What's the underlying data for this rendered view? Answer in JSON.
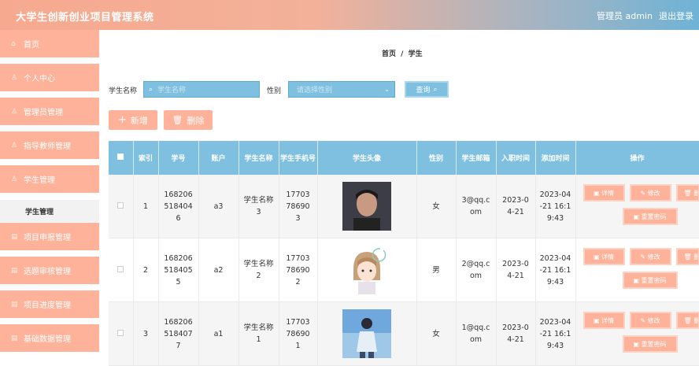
{
  "header": {
    "title": "大学生创新创业项目管理系统",
    "user": "管理员 admin",
    "logout": "退出登录"
  },
  "sidebar": {
    "items": [
      {
        "label": "首页",
        "icon": "home-icon"
      },
      {
        "label": "个人中心",
        "icon": "user-icon"
      },
      {
        "label": "管理员管理",
        "icon": "user-icon"
      },
      {
        "label": "指导教师管理",
        "icon": "user-icon"
      },
      {
        "label": "学生管理",
        "icon": "user-icon"
      },
      {
        "label": "项目申报管理",
        "icon": "doc-icon"
      },
      {
        "label": "选题审核管理",
        "icon": "doc-icon"
      },
      {
        "label": "项目进度管理",
        "icon": "doc-icon"
      },
      {
        "label": "基础数据管理",
        "icon": "doc-icon"
      }
    ],
    "active_sub": "学生管理"
  },
  "breadcrumb": [
    "首页",
    "/",
    "学生"
  ],
  "search": {
    "name_label": "学生名称",
    "name_placeholder": "学生名称",
    "gender_label": "性别",
    "gender_placeholder": "请选择性别",
    "query_label": "查询"
  },
  "actions": {
    "add": "新增",
    "delete": "删除"
  },
  "table": {
    "headers": [
      "",
      "索引",
      "学号",
      "账户",
      "学生名称",
      "学生手机号",
      "学生头像",
      "性别",
      "学生邮箱",
      "入职时间",
      "添加时间",
      "操作"
    ],
    "rows": [
      {
        "index": "1",
        "id": "1682065184046",
        "account": "a3",
        "name": "学生名称3",
        "phone": "17703786903",
        "gender": "女",
        "email": "3@qq.com",
        "join": "2023-04-21",
        "added": "2023-04-21 16:19:43"
      },
      {
        "index": "2",
        "id": "1682065184055",
        "account": "a2",
        "name": "学生名称2",
        "phone": "17703786902",
        "gender": "男",
        "email": "2@qq.com",
        "join": "2023-04-21",
        "added": "2023-04-21 16:19:43"
      },
      {
        "index": "3",
        "id": "1682065184077",
        "account": "a1",
        "name": "学生名称1",
        "phone": "17703786901",
        "gender": "女",
        "email": "1@qq.com",
        "join": "2023-04-21",
        "added": "2023-04-21 16:19:43"
      }
    ],
    "ops": {
      "detail": "详情",
      "edit": "修改",
      "delete": "删除",
      "reset": "重置密码"
    }
  },
  "colors": {
    "accent": "#fdb299",
    "blue": "#7fc0e0"
  }
}
